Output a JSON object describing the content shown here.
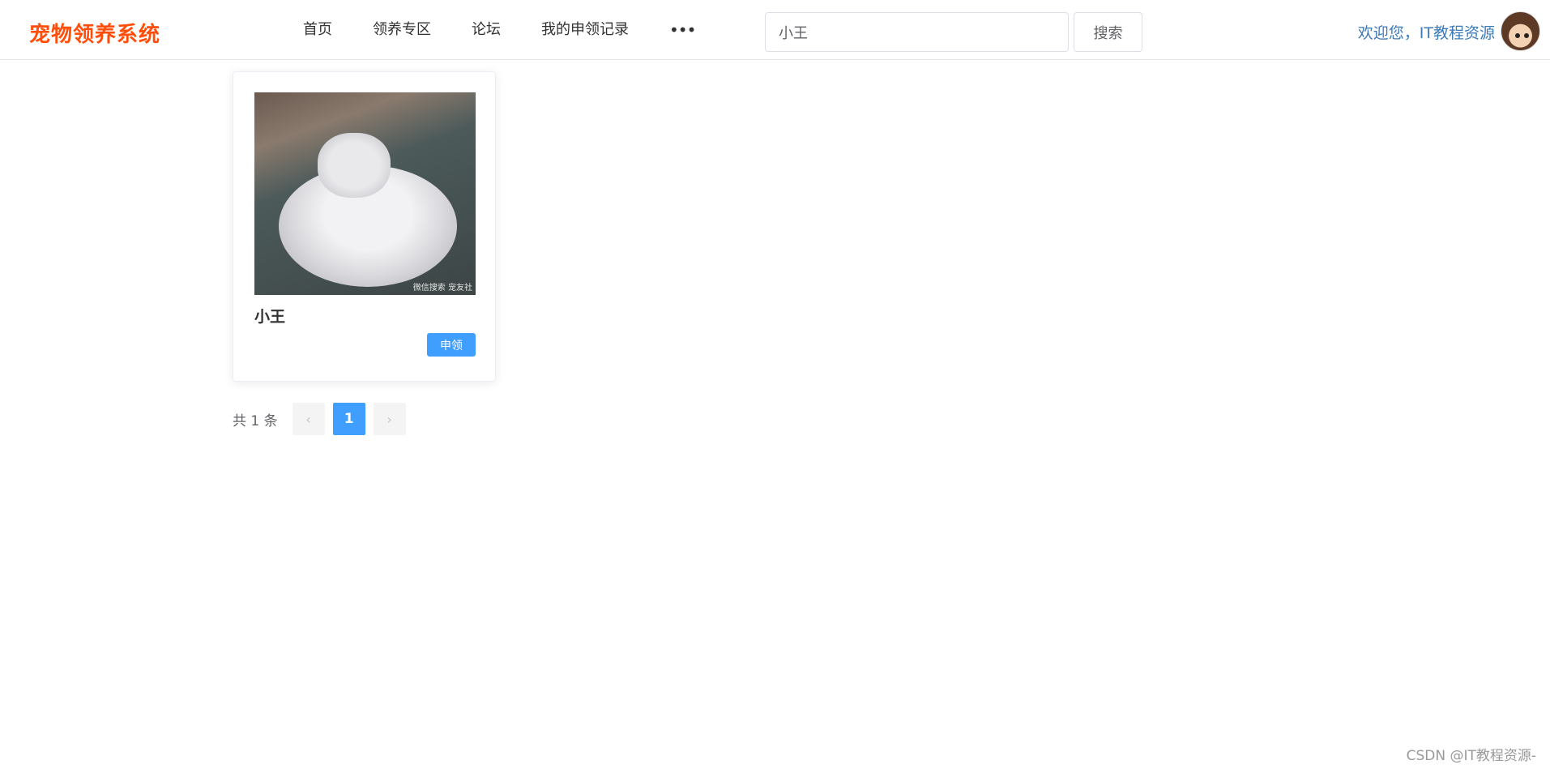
{
  "header": {
    "logo": "宠物领养系统",
    "nav": [
      "首页",
      "领养专区",
      "论坛",
      "我的申领记录"
    ],
    "more_icon": "•••",
    "search": {
      "value": "小王",
      "button_label": "搜索"
    },
    "welcome": "欢迎您，IT教程资源"
  },
  "pets": [
    {
      "name": "小王",
      "image_watermark": "微信搜索 宠友社",
      "action_label": "申领"
    }
  ],
  "pagination": {
    "total_text": "共 1 条",
    "prev_icon": "‹",
    "current_page": "1",
    "next_icon": "›"
  },
  "page_watermark": "CSDN @IT教程资源-",
  "colors": {
    "accent": "#409eff",
    "logo": "#ff4d0a",
    "welcome": "#3d7ab8"
  }
}
